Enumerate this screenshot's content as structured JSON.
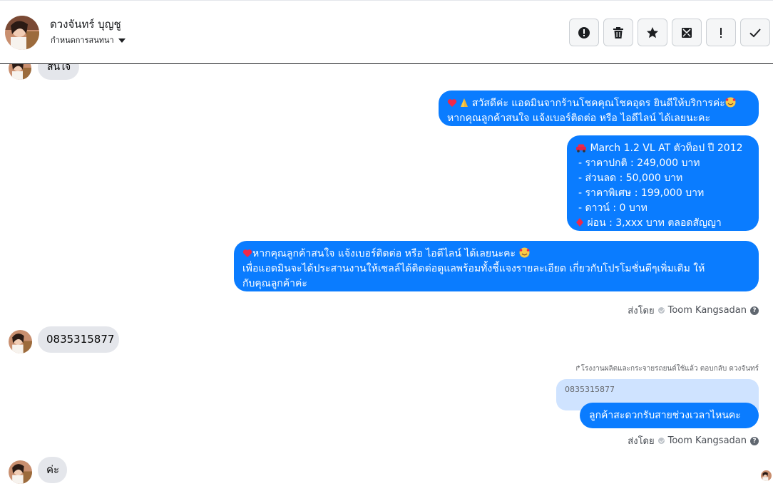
{
  "header": {
    "contact_name": "ดวงจันทร์ บุญชู",
    "assign_label": "กำหนดการสนทนา",
    "toolbar": [
      {
        "icon": "alert-circle-icon"
      },
      {
        "icon": "trash-icon"
      },
      {
        "icon": "star-icon"
      },
      {
        "icon": "mark-unread-icon"
      },
      {
        "icon": "exclamation-icon"
      },
      {
        "icon": "check-icon"
      }
    ]
  },
  "messages": {
    "partial_top": "สนใจ",
    "greeting": {
      "line1": "สวัสดีค่ะ แอดมินจากร้านโชคคุณโชคอุดร ยินดีให้บริการค่ะ",
      "line2": "หากคุณลูกค้าสนใจ แจ้งเบอร์ติดต่อ หรือ ไอดีไลน์ ได้เลยนะคะ"
    },
    "car_offer": {
      "title": "March 1.2 VL AT ตัวท็อป ปี 2012",
      "items": [
        "-  ราคาปกติ : 249,000 บาท",
        "-  ส่วนลด : 50,000 บาท",
        "-  ราคาพิเศษ : 199,000 บาท",
        "-  ดาวน์ : 0 บาท",
        "ผ่อน : 3,xxx บาท ตลอดสัญญา"
      ]
    },
    "contact_request": {
      "line1": "หากคุณลูกค้าสนใจ แจ้งเบอร์ติดต่อ หรือ ไอดีไลน์ ได้เลยนะคะ",
      "line2": "เพื่อแอดมินจะได้ประสานงานให้เซลล์ได้ติดต่อดูแลพร้อมทั้งชี้แจงรายละเอียด เกี่ยวกับโปรโมชั่นดีๆเพิ่มเติม ให้",
      "line3": "กับคุณลูกค้าค่ะ"
    },
    "sent_by_1": {
      "prefix": "ส่งโดย",
      "name": "Toom Kangsadan"
    },
    "phone": "0835315877",
    "reply_note": "โรงงานผลิตและกระจายรถยนต์ใช้แล้ว ตอบกลับ ดวงจันทร์",
    "quoted": "0835315877",
    "callback_question": "ลูกค้าสะดวกรับสายช่วงเวลาไหนคะ",
    "sent_by_2": {
      "prefix": "ส่งโดย",
      "name": "Toom Kangsadan"
    },
    "last": "ค่ะ"
  },
  "colors": {
    "outgoing_bubble": "#0a7cff",
    "incoming_bubble": "#e4e6eb",
    "quoted_bubble": "#cfe3ff"
  }
}
